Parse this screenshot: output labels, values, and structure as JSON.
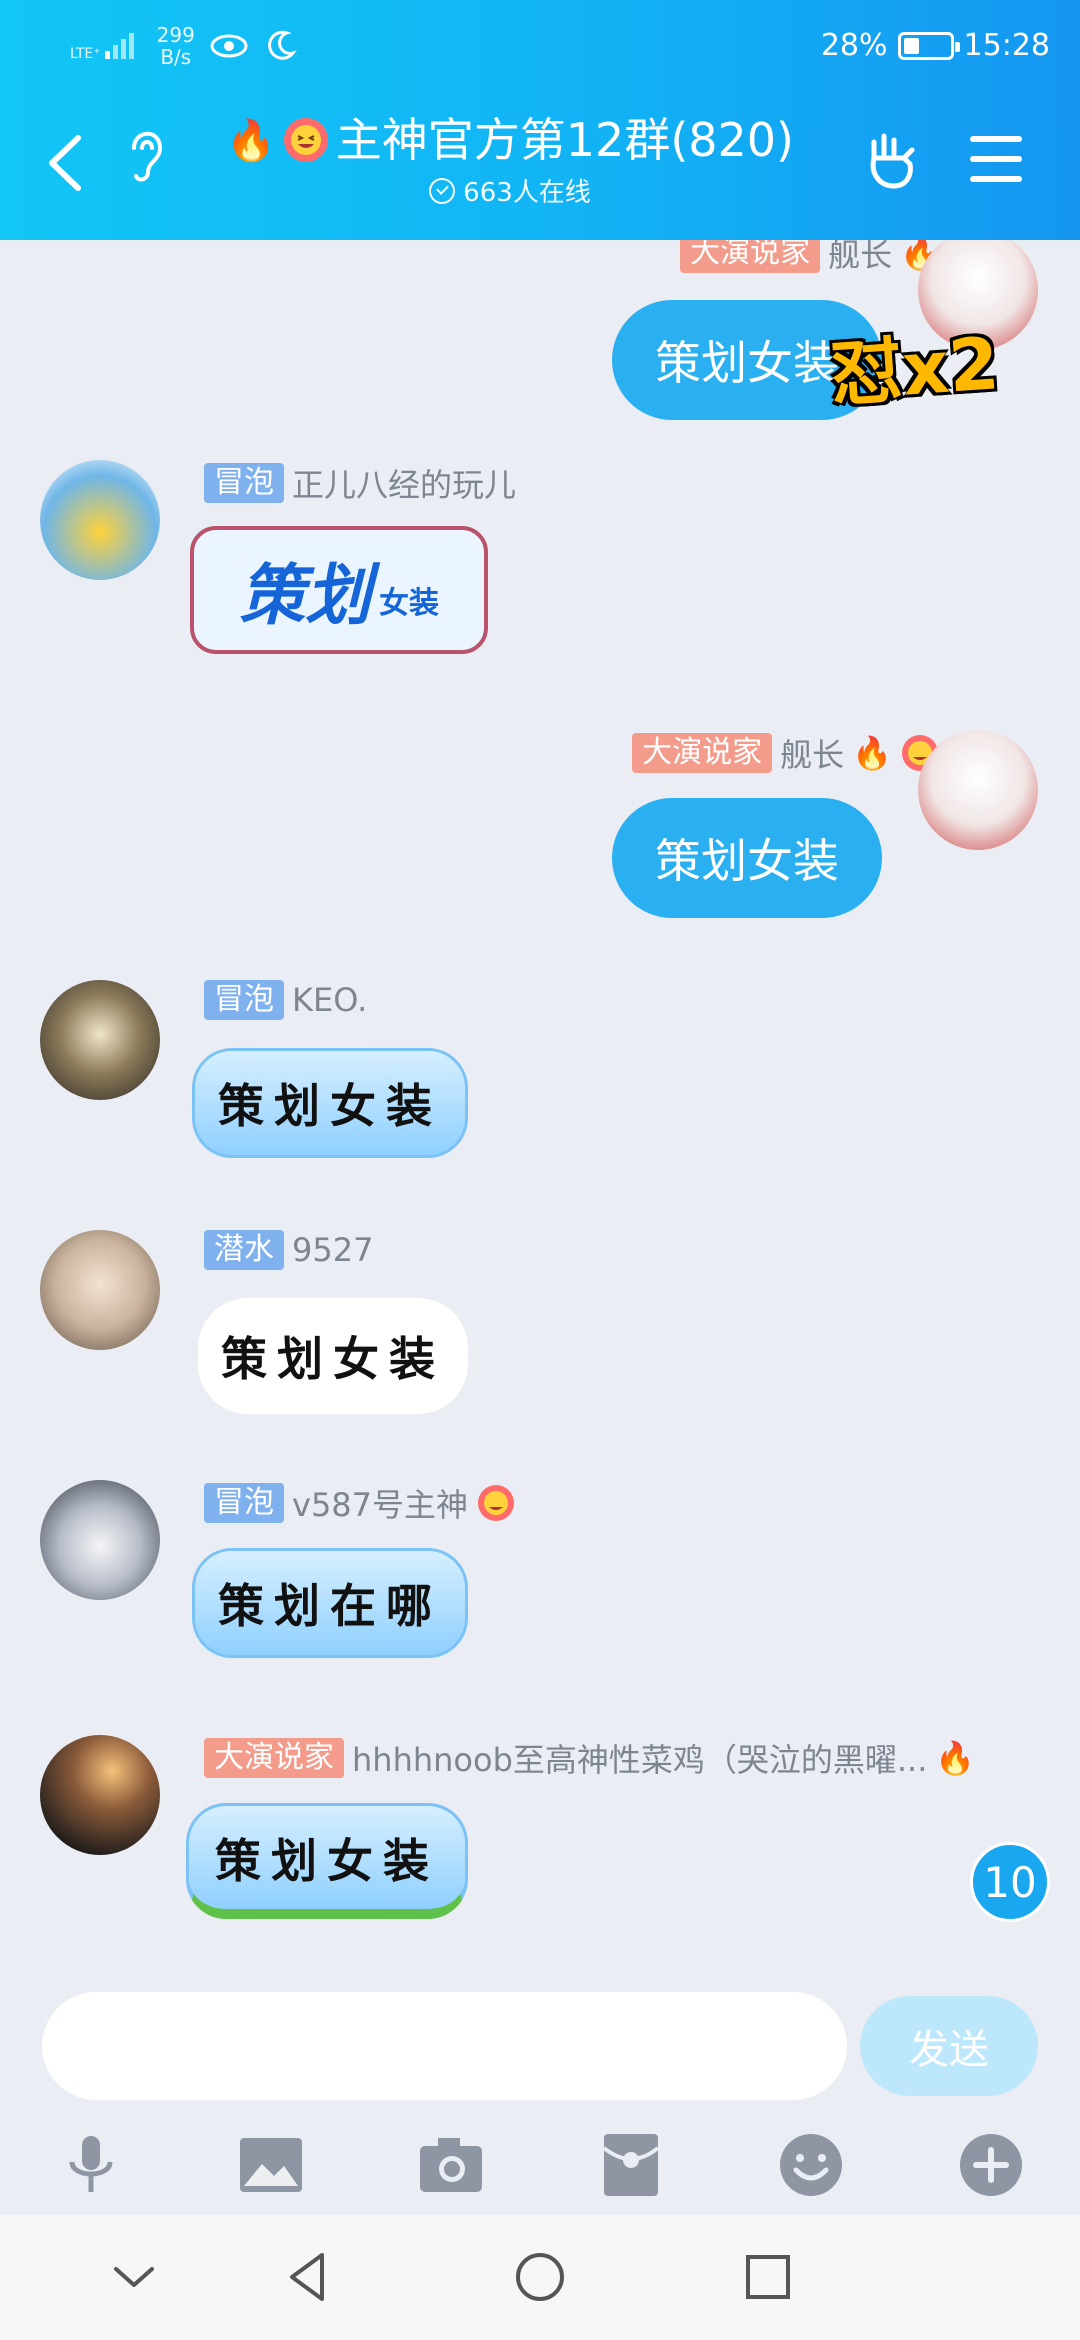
{
  "status_bar": {
    "network": "LTE⁺",
    "speed_value": "299",
    "speed_unit": "B/s",
    "battery": "28%",
    "time": "15:28"
  },
  "header": {
    "title": "主神官方第12群(820)",
    "online": "663人在线",
    "title_emoji": "🔥"
  },
  "messages": [
    {
      "tag": "大演说家",
      "name": "舰长",
      "text": "策划女装",
      "side": "right",
      "overlay": "怼x2"
    },
    {
      "tag": "冒泡",
      "name": "正儿八经的玩儿",
      "text_big": "策划",
      "text_small": "女装",
      "side": "left"
    },
    {
      "tag": "大演说家",
      "name": "舰长",
      "text": "策划女装",
      "side": "right"
    },
    {
      "tag": "冒泡",
      "name": "KEO.",
      "text": "策划女装",
      "side": "left"
    },
    {
      "tag": "潜水",
      "name": "9527",
      "text": "策划女装",
      "side": "left"
    },
    {
      "tag": "冒泡",
      "name": "v587号主神",
      "text": "策划在哪",
      "side": "left"
    },
    {
      "tag": "大演说家",
      "name": "hhhhnoob至高神性菜鸡（哭泣的黑曜...",
      "text": "策划女装",
      "side": "left"
    }
  ],
  "unread_count": "10",
  "input": {
    "placeholder": "",
    "send_label": "发送"
  },
  "colors": {
    "header": "#12b3f5",
    "bubble_self": "#2ab0f0",
    "tag_blue": "#7fb1ef",
    "tag_red": "#f49c8b"
  }
}
